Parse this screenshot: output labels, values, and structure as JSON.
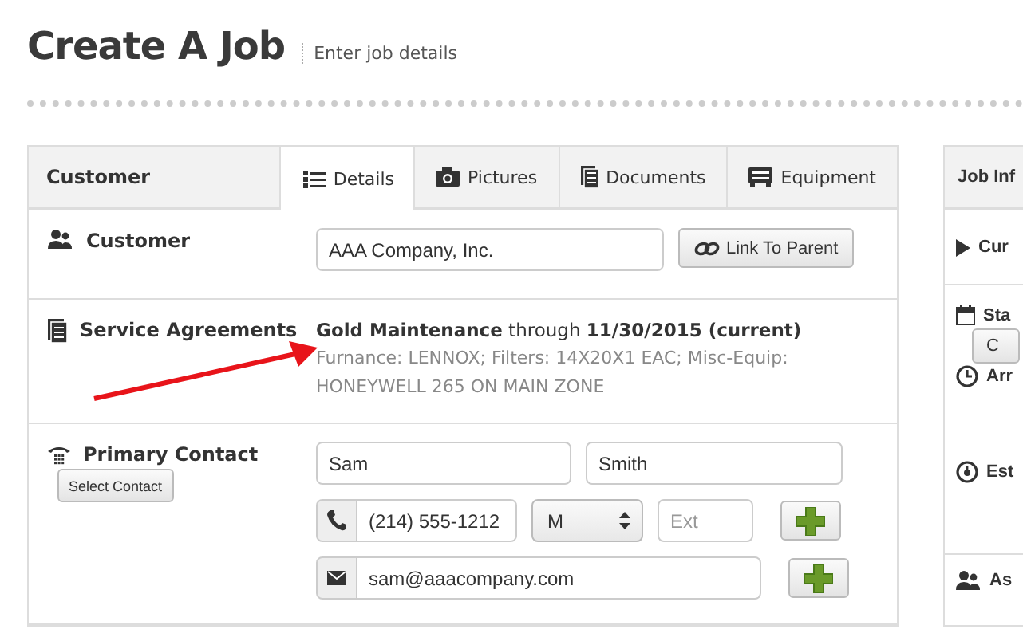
{
  "page": {
    "title": "Create A Job",
    "subtitle": "Enter job details"
  },
  "customer_panel": {
    "title": "Customer",
    "tabs": [
      {
        "label": "Details",
        "selected": true
      },
      {
        "label": "Pictures",
        "selected": false
      },
      {
        "label": "Documents",
        "selected": false
      },
      {
        "label": "Equipment",
        "selected": false
      }
    ],
    "customer": {
      "label": "Customer",
      "value": "AAA Company, Inc.",
      "button": "Link To Parent"
    },
    "service_agreements": {
      "label": "Service Agreements",
      "summary": "**Gold Maintenance** through **11/30/2015 (current)**",
      "details": "Furnance: LENNOX; Filters: 14X20X1 EAC; Misc-Equip: HONEYWELL 265 ON MAIN ZONE"
    },
    "primary_contact": {
      "label": "Primary Contact",
      "select_button": "Select Contact",
      "first_name": "Sam",
      "last_name": "Smith",
      "phone": "(214) 555-1212",
      "phone_type": "M",
      "ext_placeholder": "Ext",
      "email": "sam@aaacompany.com"
    }
  },
  "job_panel": {
    "title": "Job Inf",
    "rows": [
      {
        "label": "Cur"
      },
      {
        "label": "Sta",
        "button": "C"
      },
      {
        "label": "Arr"
      },
      {
        "label": "Est"
      },
      {
        "label": "As"
      }
    ]
  }
}
